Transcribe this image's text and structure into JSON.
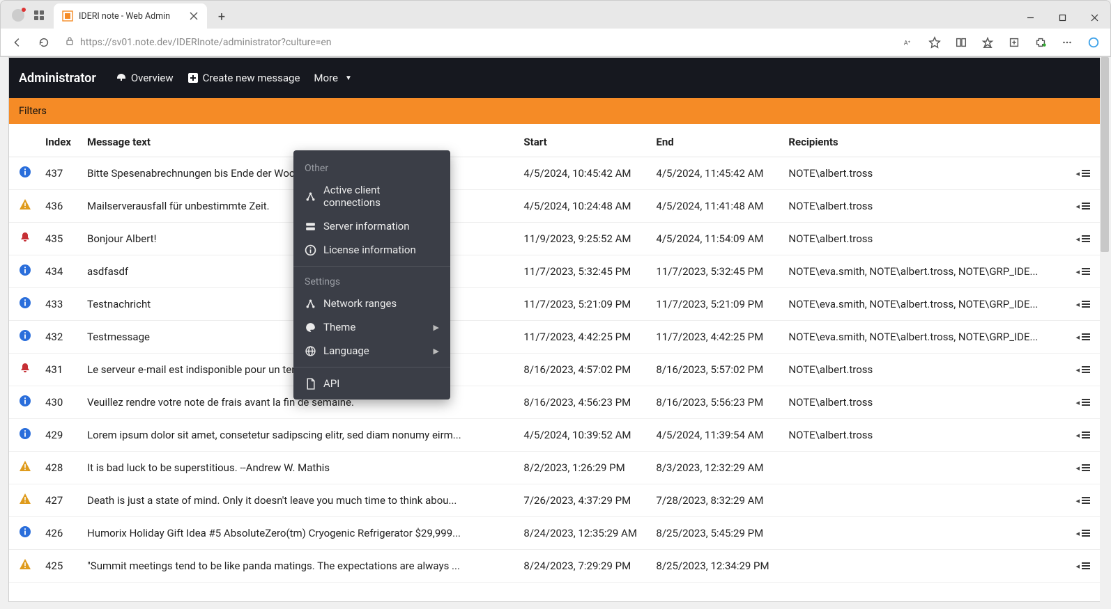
{
  "browser": {
    "tab_title": "IDERI note - Web Admin",
    "url": "https://sv01.note.dev/IDERInote/administrator?culture=en"
  },
  "navbar": {
    "brand": "Administrator",
    "overview": "Overview",
    "create": "Create new message",
    "more": "More"
  },
  "filters_label": "Filters",
  "columns": {
    "index": "Index",
    "message": "Message text",
    "start": "Start",
    "end": "End",
    "recipients": "Recipients"
  },
  "dropdown": {
    "section_other": "Other",
    "active_conn": "Active client connections",
    "server_info": "Server information",
    "license_info": "License information",
    "section_settings": "Settings",
    "network_ranges": "Network ranges",
    "theme": "Theme",
    "language": "Language",
    "api": "API"
  },
  "rows": [
    {
      "sev": "info",
      "index": "437",
      "text": "Bitte Spesenabrechnungen bis Ende der Woch",
      "start": "4/5/2024, 10:45:42 AM",
      "end": "4/5/2024, 11:45:42 AM",
      "recipients": "NOTE\\albert.tross"
    },
    {
      "sev": "warn",
      "index": "436",
      "text": "Mailserverausfall für unbestimmte Zeit.",
      "start": "4/5/2024, 10:24:48 AM",
      "end": "4/5/2024, 11:41:48 AM",
      "recipients": "NOTE\\albert.tross"
    },
    {
      "sev": "bell",
      "index": "435",
      "text": "Bonjour Albert!",
      "start": "11/9/2023, 9:25:52 AM",
      "end": "4/5/2024, 11:54:09 AM",
      "recipients": "NOTE\\albert.tross"
    },
    {
      "sev": "info",
      "index": "434",
      "text": "asdfasdf",
      "start": "11/7/2023, 5:32:45 PM",
      "end": "11/7/2023, 5:32:45 PM",
      "recipients": "NOTE\\eva.smith, NOTE\\albert.tross, NOTE\\GRP_IDE..."
    },
    {
      "sev": "info",
      "index": "433",
      "text": "Testnachricht",
      "start": "11/7/2023, 5:21:09 PM",
      "end": "11/7/2023, 5:21:09 PM",
      "recipients": "NOTE\\eva.smith, NOTE\\albert.tross, NOTE\\GRP_IDE..."
    },
    {
      "sev": "info",
      "index": "432",
      "text": "Testmessage",
      "start": "11/7/2023, 4:42:25 PM",
      "end": "11/7/2023, 4:42:25 PM",
      "recipients": "NOTE\\eva.smith, NOTE\\albert.tross, NOTE\\GRP_IDE..."
    },
    {
      "sev": "bell",
      "index": "431",
      "text": "Le serveur e-mail est indisponible pour un temps indéfini.",
      "start": "8/16/2023, 4:57:02 PM",
      "end": "8/16/2023, 5:57:02 PM",
      "recipients": "NOTE\\albert.tross"
    },
    {
      "sev": "info",
      "index": "430",
      "text": "Veuillez rendre votre note de frais avant la fin de semaine.",
      "start": "8/16/2023, 4:56:23 PM",
      "end": "8/16/2023, 5:56:23 PM",
      "recipients": "NOTE\\albert.tross"
    },
    {
      "sev": "info",
      "index": "429",
      "text": "Lorem ipsum dolor sit amet, consetetur sadipscing elitr, sed diam nonumy eirm...",
      "start": "4/5/2024, 10:39:52 AM",
      "end": "4/5/2024, 11:39:54 AM",
      "recipients": "NOTE\\albert.tross"
    },
    {
      "sev": "warn",
      "index": "428",
      "text": "It is bad luck to be superstitious. --Andrew W. Mathis",
      "start": "8/2/2023, 1:26:29 PM",
      "end": "8/3/2023, 12:32:29 AM",
      "recipients": ""
    },
    {
      "sev": "warn",
      "index": "427",
      "text": "Death is just a state of mind. Only it doesn't leave you much time to think abou...",
      "start": "7/26/2023, 4:37:29 PM",
      "end": "7/28/2023, 8:32:29 AM",
      "recipients": ""
    },
    {
      "sev": "info",
      "index": "426",
      "text": "Humorix Holiday Gift Idea #5 AbsoluteZero(tm) Cryogenic Refrigerator $29,999...",
      "start": "8/24/2023, 12:35:29 AM",
      "end": "8/25/2023, 5:45:29 PM",
      "recipients": ""
    },
    {
      "sev": "warn",
      "index": "425",
      "text": "\"Summit meetings tend to be like panda matings. The expectations are always ...",
      "start": "8/24/2023, 7:29:29 PM",
      "end": "8/25/2023, 12:34:29 PM",
      "recipients": ""
    }
  ]
}
